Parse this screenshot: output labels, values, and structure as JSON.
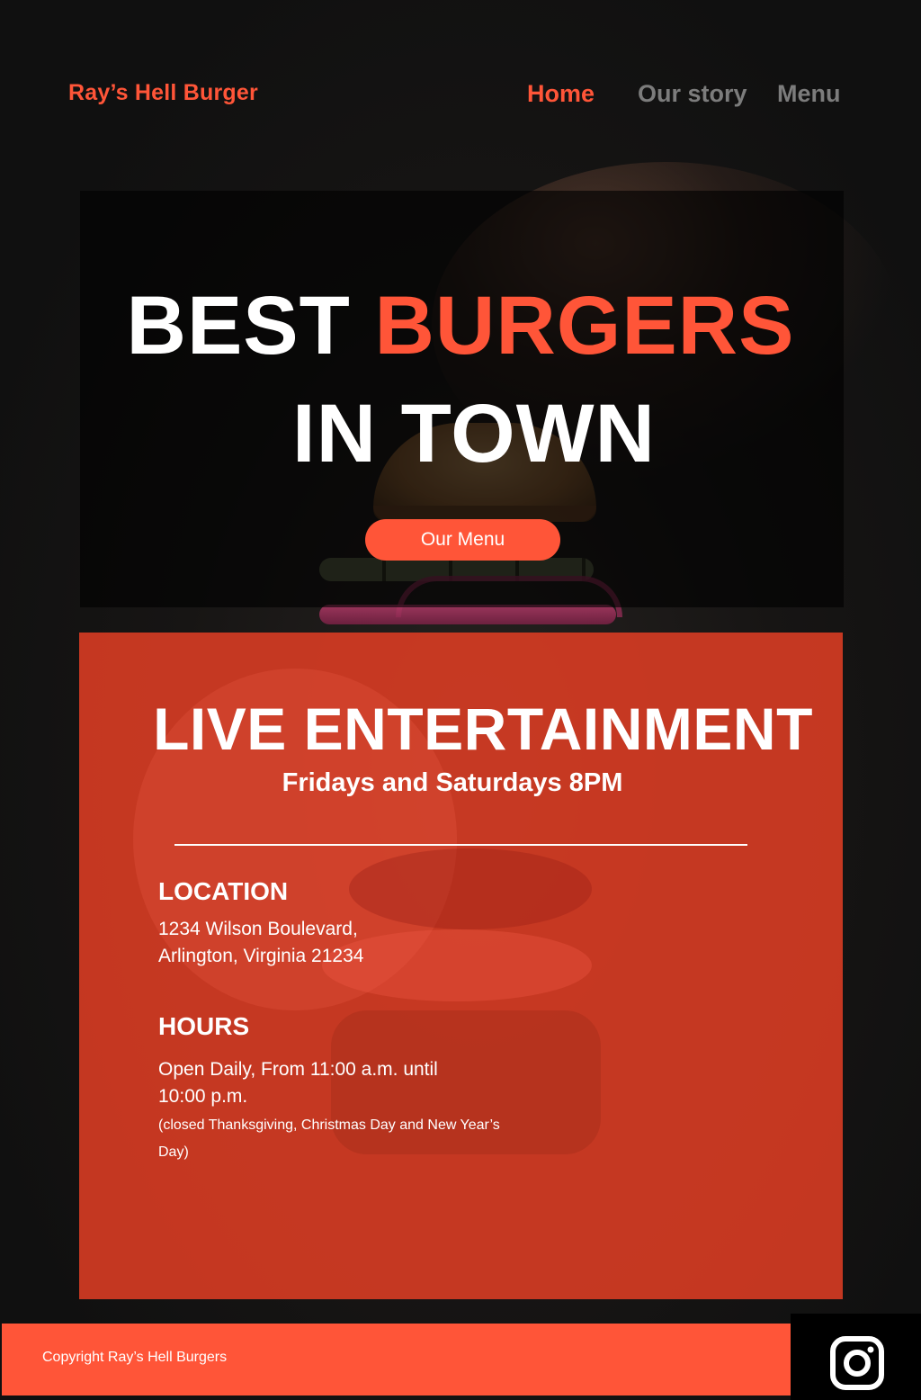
{
  "nav": {
    "brand": "Ray’s Hell Burger",
    "links": [
      {
        "label": "Home",
        "active": true
      },
      {
        "label": "Our story",
        "active": false
      },
      {
        "label": "Menu",
        "active": false
      }
    ]
  },
  "hero": {
    "line1_word1": "BEST",
    "line1_word2": "BURGERS",
    "line2": "IN TOWN",
    "button_label": "Our Menu"
  },
  "entertainment": {
    "title": "LIVE ENTERTAINMENT",
    "schedule": "Fridays and Saturdays 8PM"
  },
  "location": {
    "heading": "LOCATION",
    "address_line1": "1234 Wilson Boulevard,",
    "address_line2": "Arlington, Virginia 21234"
  },
  "hours": {
    "heading": "HOURS",
    "text": "Open Daily, From 11:00 a.m. until 10:00 p.m.",
    "note": " (closed Thanksgiving,  Christmas Day and New Year’s Day)"
  },
  "footer": {
    "copyright": "Copyright Ray’s Hell Burgers",
    "social_icon": "instagram-icon"
  },
  "colors": {
    "accent": "#ff5538",
    "background": "#121212",
    "info_panel": "#d83c24",
    "nav_inactive": "#7c7c7c"
  }
}
